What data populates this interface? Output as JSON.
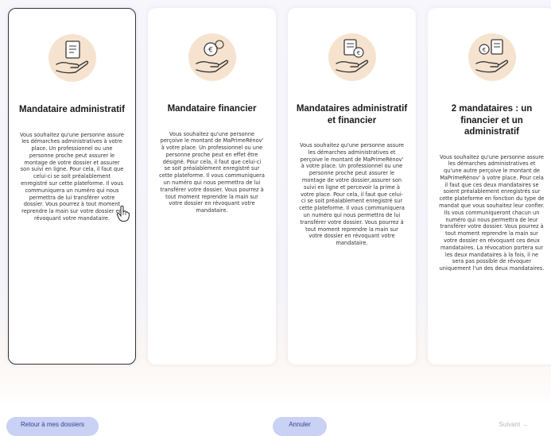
{
  "cards": [
    {
      "title": "Mandataire administratif",
      "description": "Vous souhaitez qu'une personne assure les démarches administratives à votre place. Un professionnel ou une personne proche peut assurer le montage de votre dossier et assurer son suivi en ligne. Pour cela, il faut que celui-ci se soit préalablement enregistré sur cette plateforme. Il vous communiquera un numéro qui nous permettra de lui transférer votre dossier. Vous pourrez à tout moment reprendre la main sur votre dossier en révoquant votre mandataire.",
      "selected": true
    },
    {
      "title": "Mandataire financier",
      "description": "Vous souhaitez qu'une personne perçoive le montant de MaPrimeRénov' à votre place. Un professionnel ou une personne proche peut en effet être désigné. Pour cela, il faut que celui-ci se soit préalablement enregistré sur cette plateforme. Il vous communiquera un numéro qui nous permettra de lui transférer votre dossier. Vous pourrez à tout moment reprendre la main sur votre dossier en révoquant votre mandataire.",
      "selected": false
    },
    {
      "title": "Mandataires administratif et financier",
      "description": "Vous souhaitez qu'une personne assure les démarches administratives et perçoive le montant de MaPrimeRénov' à votre place. Un professionnel ou une personne proche peut assurer le montage de votre dossier,assurer son suivi en ligne et percevoir la prime à votre place. Pour cela, il faut que celui-ci se soit préalablement enregistré sur cette plateforme. Il vous communiquera un numéro qui nous permettra de lui transférer votre dossier. Vous pourrez à tout moment reprendre la main sur votre dossier en révoquant votre mandataire.",
      "selected": false
    },
    {
      "title": "2 mandataires : un financier et un administratif",
      "description": "Vous souhaitez qu'une personne assure les démarches administratives et qu'une autre perçoive le montant de MaPrimeRénov' à votre place. Pour cela il faut que ces deux mandataires se soient préalablement enregistrés sur cette plateforme en fonction du type de mandat que vous souhaitez leur confier. Ils vous communiqueront chacun un numéro qui nous permettra de leur transférer votre dossier. Vous pourrez à tout moment reprendre la main sur votre dossier en révoquant ces deux mandataires. La révocation portera sur les deux mandataires à la fois, il ne sera pas possible de révoquer uniquement l'un des deux mandataires.",
      "selected": false
    }
  ],
  "footer": {
    "back_label": "Retour à mes dossiers",
    "cancel_label": "Annuler",
    "next_label": "Suivant →"
  },
  "colors": {
    "illustration_bg": "#f6e3cf",
    "button_bg": "#c9d1f4",
    "button_text": "#3a3f8f",
    "disabled_text": "#b7b7bf"
  },
  "icons": [
    "document-hand-icon",
    "coin-hand-icon",
    "document-coin-hand-icon",
    "two-documents-hand-icon",
    "hand-pointer-icon"
  ]
}
